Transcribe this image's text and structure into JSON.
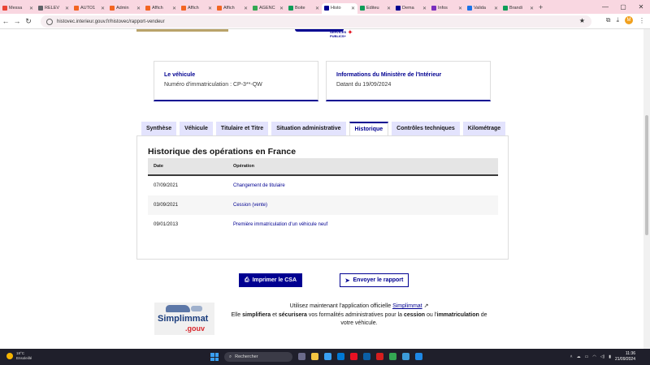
{
  "browser": {
    "tabs": [
      {
        "label": "Messa",
        "color": "#ea4335",
        "icon": "gmail-icon"
      },
      {
        "label": "RELEV",
        "color": "#5f6368",
        "icon": "globe-icon"
      },
      {
        "label": "AUTO1",
        "color": "#f26522",
        "icon": "auto1-icon"
      },
      {
        "label": "Admin",
        "color": "#f26522",
        "icon": "auto1-icon"
      },
      {
        "label": "Affich",
        "color": "#f26522",
        "icon": "auto1-icon"
      },
      {
        "label": "Affich",
        "color": "#f26522",
        "icon": "auto1-icon"
      },
      {
        "label": "Affich",
        "color": "#f26522",
        "icon": "auto1-icon"
      },
      {
        "label": "AGENC",
        "color": "#34a853",
        "icon": "leaf-icon"
      },
      {
        "label": "Boite",
        "color": "#0f9d58",
        "icon": "sheets-icon"
      },
      {
        "label": "Histo",
        "color": "#000091",
        "icon": "france-flag-icon",
        "active": true
      },
      {
        "label": "Editeu",
        "color": "#0f9d58",
        "icon": "sheets-icon"
      },
      {
        "label": "Dema",
        "color": "#000091",
        "icon": "france-flag-icon"
      },
      {
        "label": "Infos",
        "color": "#7b2fbe",
        "icon": "info-icon"
      },
      {
        "label": "Valida",
        "color": "#1a73e8",
        "icon": "calendar-icon"
      },
      {
        "label": "Brandi",
        "color": "#0f9d58",
        "icon": "sheets-icon"
      }
    ],
    "new_tab": "+",
    "url": "histovec.interieur.gouv.fr/histovec/rapport-vendeur",
    "avatar_letter": "M"
  },
  "header": {
    "gov_logo_line1": "SERVICES",
    "gov_logo_line2": "PUBLICS+"
  },
  "vehicle_card": {
    "title": "Le véhicule",
    "text": "Numéro d'immatriculation : CP-3**-QW"
  },
  "ministry_card": {
    "title": "Informations du Ministère de l'Intérieur",
    "text": "Datant du 19/09/2024"
  },
  "tabs": [
    {
      "label": "Synthèse"
    },
    {
      "label": "Véhicule"
    },
    {
      "label": "Titulaire et Titre"
    },
    {
      "label": "Situation administrative"
    },
    {
      "label": "Historique",
      "active": true
    },
    {
      "label": "Contrôles techniques"
    },
    {
      "label": "Kilométrage"
    }
  ],
  "history": {
    "title": "Historique des opérations en France",
    "col_date": "Date",
    "col_operation": "Opération",
    "rows": [
      {
        "date": "07/09/2021",
        "operation": "Changement de titulaire"
      },
      {
        "date": "03/09/2021",
        "operation": "Cession (vente)"
      },
      {
        "date": "09/01/2013",
        "operation": "Première immatriculation d'un véhicule neuf"
      }
    ]
  },
  "actions": {
    "print_label": "Imprimer le CSA",
    "send_label": "Envoyer le rapport"
  },
  "promo": {
    "logo_main": "Simplimmat",
    "logo_sub": ".gouv",
    "line1_prefix": "Utilisez maintenant l'application officielle ",
    "line1_link": "Simplimmat",
    "line2_a": "Elle ",
    "line2_b": "simplifiera",
    "line2_c": " et ",
    "line2_d": "sécurisera",
    "line2_e": " vos formalités administratives pour la ",
    "line2_f": "cession",
    "line2_g": " ou l'",
    "line2_h": "immatriculation",
    "line2_i": " de",
    "line3": "votre véhicule."
  },
  "taskbar": {
    "temp": "18°C",
    "weather": "Ensoleillé",
    "search_placeholder": "Rechercher",
    "time": "11:36",
    "date": "21/09/2024"
  }
}
